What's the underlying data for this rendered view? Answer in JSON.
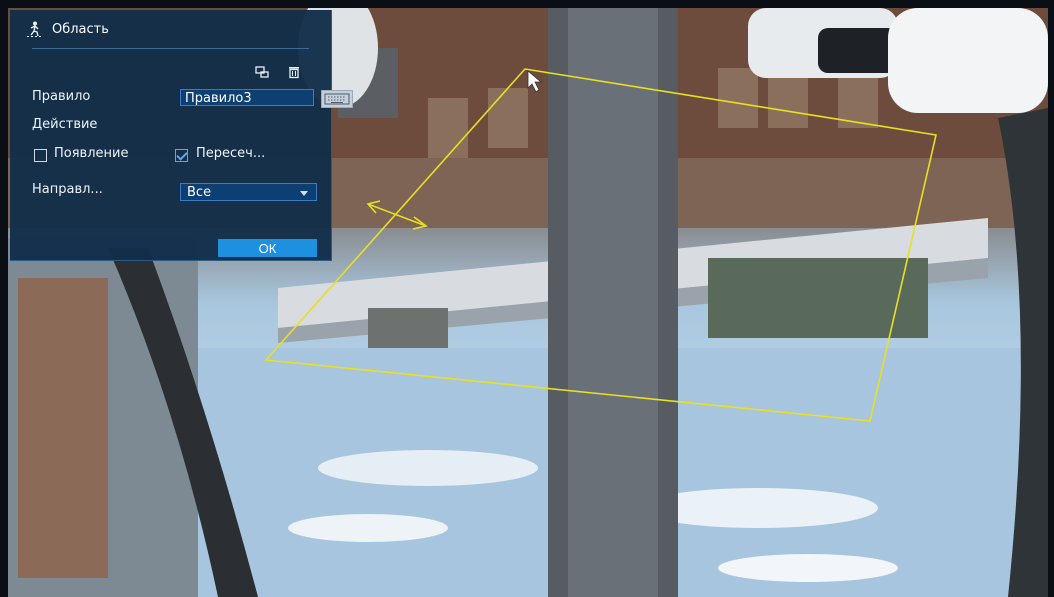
{
  "panel": {
    "title": "Область",
    "title_icon": "person-crossing-icon",
    "tools": [
      "draw-area-icon",
      "delete-icon"
    ],
    "rule_label": "Правило",
    "rule_value": "Правило3",
    "keyboard_icon": "keyboard-icon",
    "action_label": "Действие",
    "options": [
      {
        "label": "Появление",
        "checked": false
      },
      {
        "label": "Пересеч...",
        "checked": true
      }
    ],
    "direction_label": "Направл...",
    "direction_value": "Все",
    "ok_label": "ОК"
  },
  "overlay": {
    "zone_color": "#e8e020",
    "arrow_color": "#e8e020",
    "cursor": "mouse-pointer-icon"
  }
}
